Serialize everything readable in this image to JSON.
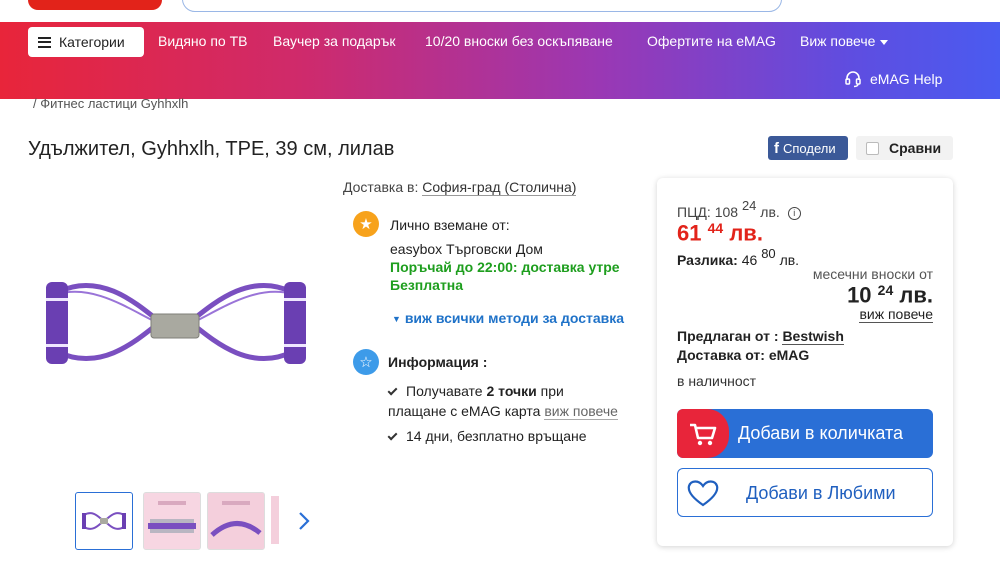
{
  "nav": {
    "categories": "Категории",
    "items": [
      "Видяно по ТВ",
      "Ваучер за подарък",
      "10/20 вноски без оскъпяване",
      "Офертите на eMAG",
      "Виж повече"
    ],
    "help": "eMAG Help"
  },
  "breadcrumb": "/ Фитнес ластици Gyhhxlh",
  "product": {
    "title": "Удължител, Gyhhxlh, TPE, 39 см, лилав",
    "share": "Сподели",
    "compare": "Сравни"
  },
  "delivery": {
    "to_label": "Доставка в:",
    "location": "София-град (Столична)",
    "pickup_title": "Лично вземане от:",
    "pickup_place": "easybox Търговски Дом",
    "pickup_deadline": "Поръчай до 22:00: доставка утре",
    "pickup_free": "Безплатна",
    "all_methods": "виж всички методи за доставка"
  },
  "info": {
    "title": "Информация :",
    "points_prefix": "Получавате ",
    "points_bold": "2 точки",
    "points_suffix": " при",
    "points_line2": "плащане с eMAG карта",
    "points_more": "виж повече",
    "returns": "14 дни, безплатно връщане"
  },
  "pricing": {
    "pcd_label": "ПЦД:",
    "pcd_int": "108",
    "pcd_dec": "24",
    "pcd_cur": "лв.",
    "price_int": "61",
    "price_dec": "44",
    "price_cur": "лв.",
    "diff_label": "Разлика:",
    "diff_int": "46",
    "diff_dec": "80",
    "diff_cur": "лв.",
    "monthly_label": "месечни вноски от",
    "monthly_int": "10",
    "monthly_dec": "24",
    "monthly_cur": "лв.",
    "monthly_more": "виж повече",
    "seller_label": "Предлаган от :",
    "seller": "Bestwish",
    "delivered_by": "Доставка от: eMAG",
    "availability": "в наличност",
    "add_to_cart": "Добави в количката",
    "add_to_fav": "Добави в Любими"
  },
  "colors": {
    "accent_blue": "#2a6fd6",
    "price_red": "#e2231a",
    "green": "#1e9e1e",
    "product_purple": "#7a4fc0"
  }
}
